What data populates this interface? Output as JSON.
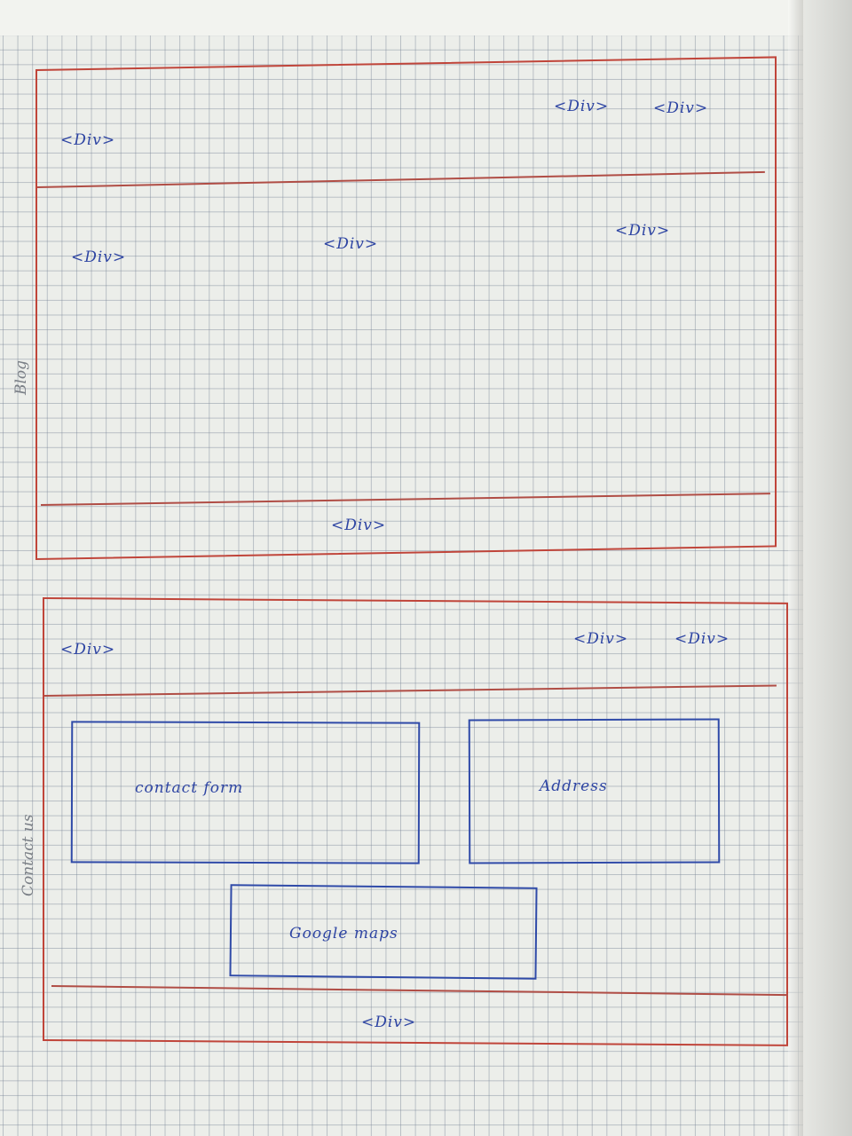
{
  "sections": {
    "blog": {
      "side_label": "Blog",
      "header": {
        "left_tag": "<Div>",
        "right_tag_1": "<Div>",
        "right_tag_2": "<Div>"
      },
      "content": {
        "left_tag": "<Div>",
        "center_tag": "<Div>",
        "right_tag": "<Div>"
      },
      "footer": {
        "tag": "<Div>"
      }
    },
    "contact": {
      "side_label": "Contact us",
      "header": {
        "left_tag": "<Div>",
        "right_tag_1": "<Div>",
        "right_tag_2": "<Div>"
      },
      "content": {
        "contact_form": "contact form",
        "address": "Address",
        "google_maps": "Google maps"
      },
      "footer": {
        "tag": "<Div>"
      }
    }
  },
  "colors": {
    "paper": "#eceeea",
    "grid": "#7884969",
    "section_border": "#c0453a",
    "ink": "#2e45a3",
    "pencil": "#7a7f86"
  }
}
